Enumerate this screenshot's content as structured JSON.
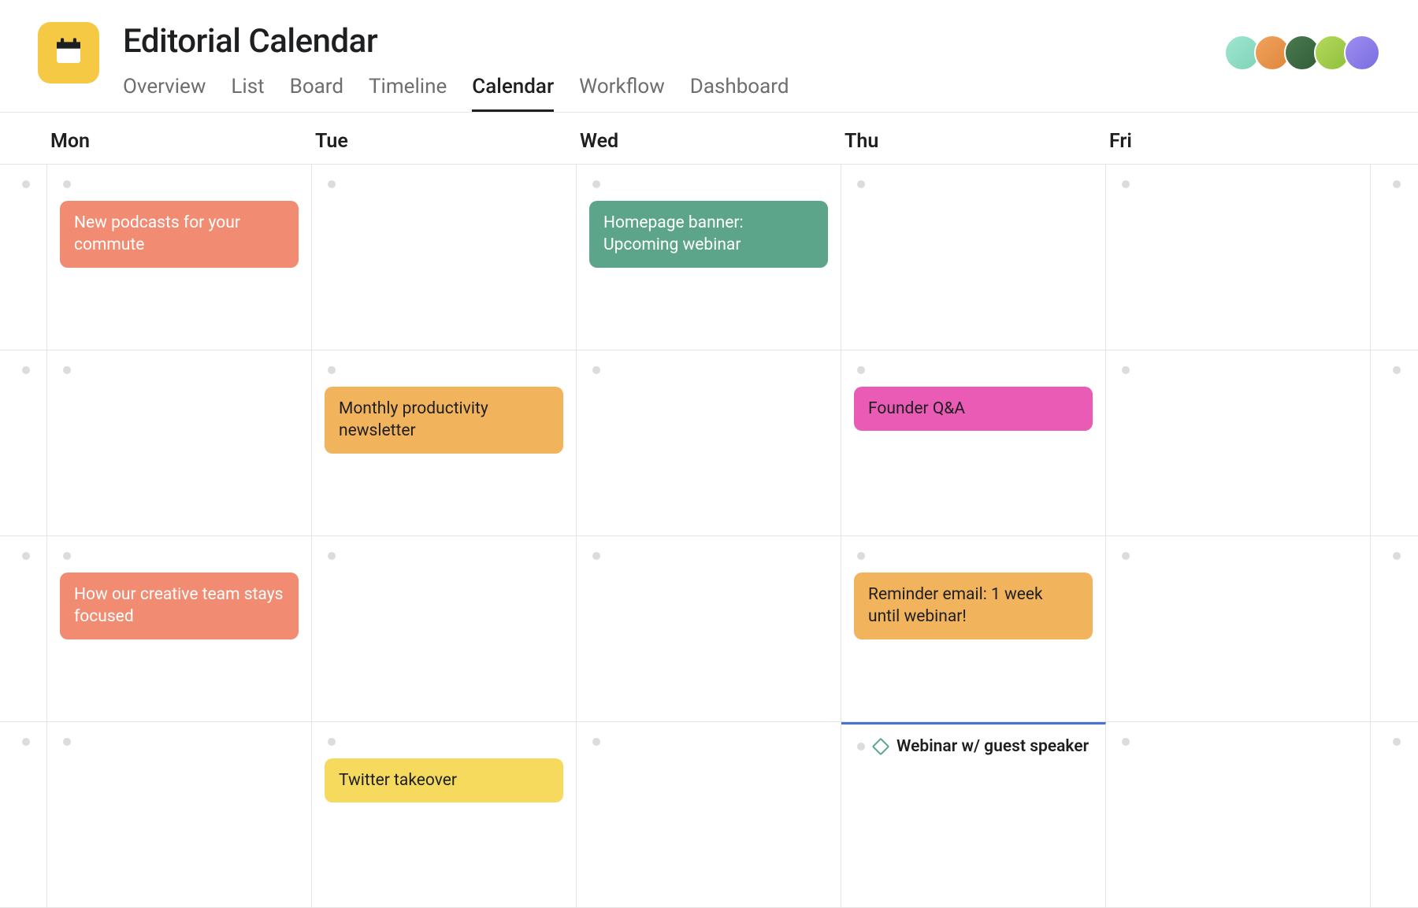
{
  "header": {
    "title": "Editorial Calendar",
    "tabs": {
      "overview": "Overview",
      "list": "List",
      "board": "Board",
      "timeline": "Timeline",
      "calendar": "Calendar",
      "workflow": "Workflow",
      "dashboard": "Dashboard"
    }
  },
  "days": {
    "mon": "Mon",
    "tue": "Tue",
    "wed": "Wed",
    "thu": "Thu",
    "fri": "Fri"
  },
  "events": {
    "podcasts": "New podcasts for your commute",
    "homepage_banner": "Homepage banner: Upcoming webinar",
    "newsletter": "Monthly productivity newsletter",
    "founder_qa": "Founder Q&A",
    "creative_team": "How our creative team stays focused",
    "reminder_email": "Reminder email: 1 week until webinar!",
    "twitter": "Twitter takeover",
    "webinar_guest": "Webinar w/ guest speaker"
  }
}
